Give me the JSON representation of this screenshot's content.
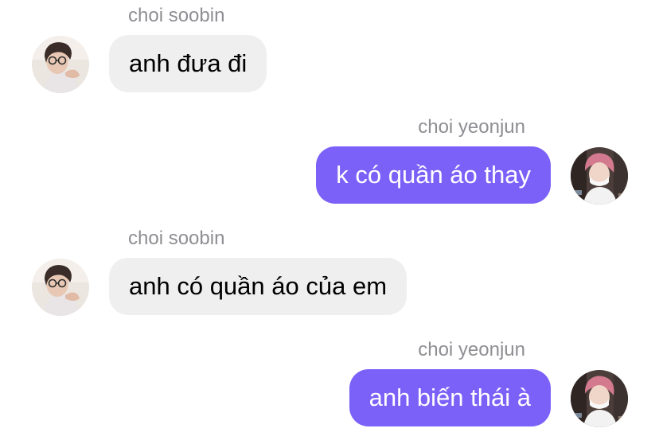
{
  "messages": [
    {
      "sender": "choi soobin",
      "text": "anh đưa đi",
      "direction": "incoming"
    },
    {
      "sender": "choi yeonjun",
      "text": "k có quần áo thay",
      "direction": "outgoing"
    },
    {
      "sender": "choi soobin",
      "text": "anh có quần áo của em",
      "direction": "incoming"
    },
    {
      "sender": "choi yeonjun",
      "text": "anh biến thái à",
      "direction": "outgoing"
    }
  ],
  "colors": {
    "incoming_bubble": "#efefef",
    "outgoing_bubble": "#7b61f8",
    "sender_name": "#8e8e93"
  }
}
